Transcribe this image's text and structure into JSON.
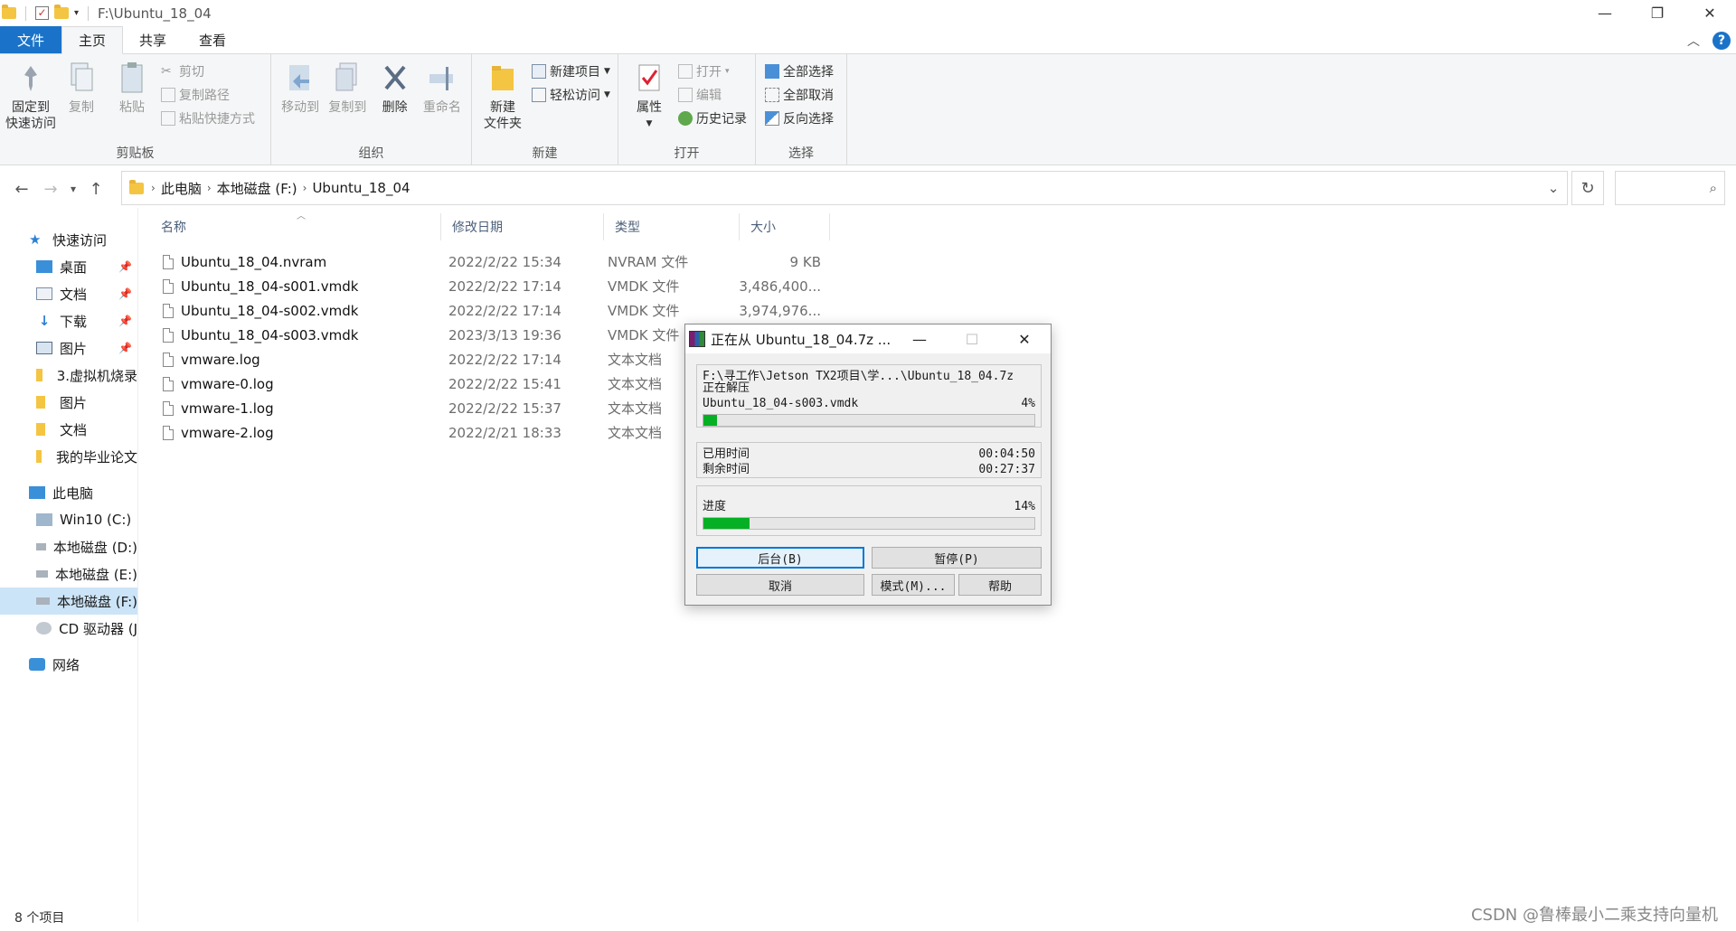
{
  "window": {
    "path": "F:\\Ubuntu_18_04",
    "min": "—",
    "max": "❐",
    "close": "✕"
  },
  "tabs": [
    "文件",
    "主页",
    "共享",
    "查看"
  ],
  "ribbon": {
    "clipboard": {
      "label": "剪贴板",
      "pin": "固定到\n快速访问",
      "copy": "复制",
      "paste": "粘贴",
      "cut": "剪切",
      "copy_path": "复制路径",
      "paste_shortcut": "粘贴快捷方式"
    },
    "organize": {
      "label": "组织",
      "move_to": "移动到",
      "copy_to": "复制到",
      "delete": "删除",
      "rename": "重命名"
    },
    "new": {
      "label": "新建",
      "new_folder": "新建\n文件夹",
      "new_item": "新建项目",
      "easy_access": "轻松访问"
    },
    "open": {
      "label": "打开",
      "properties": "属性",
      "open": "打开",
      "edit": "编辑",
      "history": "历史记录"
    },
    "select": {
      "label": "选择",
      "select_all": "全部选择",
      "select_none": "全部取消",
      "invert": "反向选择"
    }
  },
  "address": {
    "crumbs": [
      "此电脑",
      "本地磁盘 (F:)",
      "Ubuntu_18_04"
    ]
  },
  "sidebar": {
    "quick_access": "快速访问",
    "quick_items": [
      "桌面",
      "文档",
      "下载",
      "图片",
      "3.虚拟机烧录",
      "图片",
      "文档",
      "我的毕业论文"
    ],
    "this_pc": "此电脑",
    "drives": [
      "Win10 (C:)",
      "本地磁盘 (D:)",
      "本地磁盘 (E:)",
      "本地磁盘 (F:)",
      "CD 驱动器 (J"
    ],
    "network": "网络"
  },
  "columns": {
    "name": "名称",
    "date": "修改日期",
    "type": "类型",
    "size": "大小"
  },
  "files": [
    {
      "name": "Ubuntu_18_04.nvram",
      "date": "2022/2/22 15:34",
      "type": "NVRAM 文件",
      "size": "9 KB"
    },
    {
      "name": "Ubuntu_18_04-s001.vmdk",
      "date": "2022/2/22 17:14",
      "type": "VMDK 文件",
      "size": "3,486,400..."
    },
    {
      "name": "Ubuntu_18_04-s002.vmdk",
      "date": "2022/2/22 17:14",
      "type": "VMDK 文件",
      "size": "3,974,976..."
    },
    {
      "name": "Ubuntu_18_04-s003.vmdk",
      "date": "2023/3/13 19:36",
      "type": "VMDK 文件",
      "size": ""
    },
    {
      "name": "vmware.log",
      "date": "2022/2/22 17:14",
      "type": "文本文档",
      "size": ""
    },
    {
      "name": "vmware-0.log",
      "date": "2022/2/22 15:41",
      "type": "文本文档",
      "size": ""
    },
    {
      "name": "vmware-1.log",
      "date": "2022/2/22 15:37",
      "type": "文本文档",
      "size": ""
    },
    {
      "name": "vmware-2.log",
      "date": "2022/2/21 18:33",
      "type": "文本文档",
      "size": ""
    }
  ],
  "status": "8 个项目",
  "watermark": "CSDN @鲁棒最小二乘支持向量机",
  "dialog": {
    "title": "正在从 Ubuntu_18_04.7z ...",
    "archive_path": "F:\\寻工作\\Jetson TX2项目\\学...\\Ubuntu_18_04.7z",
    "action": "正在解压",
    "current_file": "Ubuntu_18_04-s003.vmdk",
    "file_percent_text": "4%",
    "file_progress": 0.04,
    "elapsed_label": "已用时间",
    "elapsed": "00:04:50",
    "remaining_label": "剩余时间",
    "remaining": "00:27:37",
    "progress_label": "进度",
    "total_percent_text": "14%",
    "total_progress": 0.14,
    "buttons": {
      "background": "后台(B)",
      "pause": "暂停(P)",
      "cancel": "取消",
      "mode": "模式(M)...",
      "help": "帮助"
    }
  }
}
